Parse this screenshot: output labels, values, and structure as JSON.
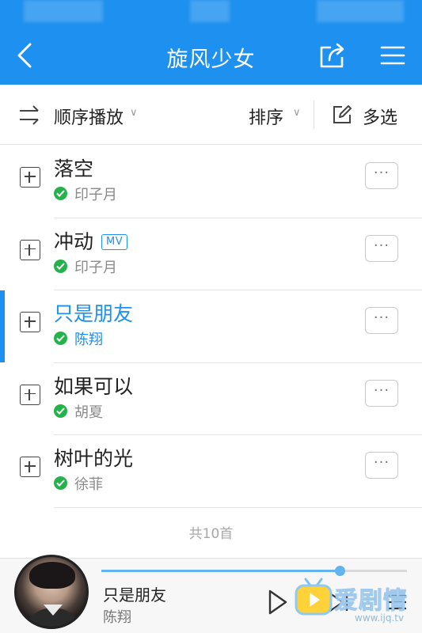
{
  "header": {
    "title": "旋风少女",
    "bg_color": "#1e90ef"
  },
  "toolbar": {
    "play_mode_label": "顺序播放",
    "sort_label": "排序",
    "multi_select_label": "多选"
  },
  "songs": [
    {
      "title": "落空",
      "artist": "印子月",
      "badge": "",
      "active": false
    },
    {
      "title": "冲动",
      "artist": "印子月",
      "badge": "MV",
      "active": false
    },
    {
      "title": "只是朋友",
      "artist": "陈翔",
      "badge": "",
      "active": true
    },
    {
      "title": "如果可以",
      "artist": "胡夏",
      "badge": "",
      "active": false
    },
    {
      "title": "树叶的光",
      "artist": "徐菲",
      "badge": "",
      "active": false
    }
  ],
  "count_label": "共10首",
  "player": {
    "title": "只是朋友",
    "artist": "陈翔",
    "progress": 0.78,
    "accent": "#62b4ef"
  },
  "watermark": {
    "text": "爱剧情",
    "url": "www.ijq.tv"
  }
}
